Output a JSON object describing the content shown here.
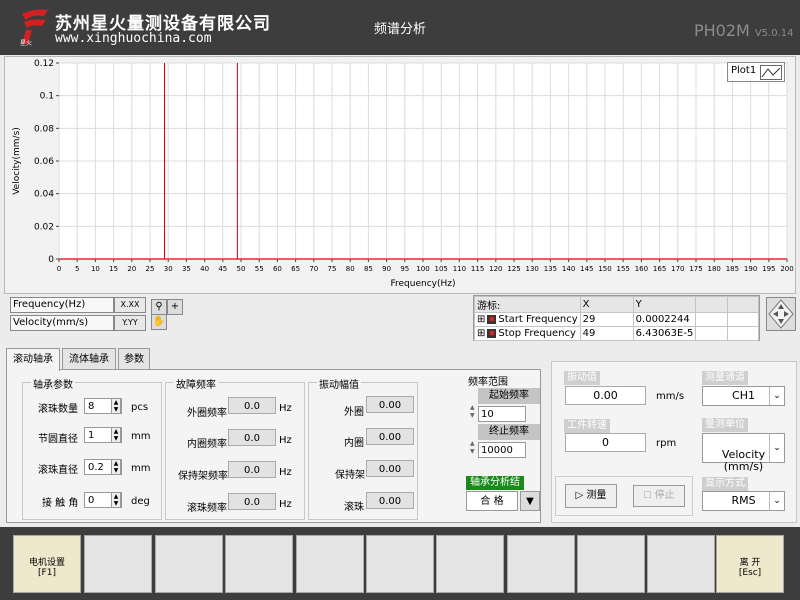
{
  "header": {
    "company_cn": "苏州星火量测设备有限公司",
    "company_url": "www.xinghuochina.com",
    "title": "频谱分析",
    "model": "PH02M",
    "version": "V5.0.14",
    "brand_color": "#d42020"
  },
  "plot": {
    "legend_label": "Plot1"
  },
  "chart_data": {
    "type": "line",
    "xlabel": "Frequency(Hz)",
    "ylabel": "Velocity(mm/s)",
    "xlim": [
      0,
      200
    ],
    "ylim": [
      0,
      0.12
    ],
    "x_ticks": [
      0,
      5,
      10,
      15,
      20,
      25,
      30,
      35,
      40,
      45,
      50,
      55,
      60,
      65,
      70,
      75,
      80,
      85,
      90,
      95,
      100,
      105,
      110,
      115,
      120,
      125,
      130,
      135,
      140,
      145,
      150,
      155,
      160,
      165,
      170,
      175,
      180,
      185,
      190,
      195,
      200
    ],
    "y_ticks": [
      0,
      0.02,
      0.04,
      0.06,
      0.08,
      0.1,
      0.12
    ],
    "y_tick_labels": [
      "0",
      "0.02",
      "0.04",
      "0.06",
      "0.08",
      "0.1",
      "0.12"
    ],
    "grid": true,
    "series": [
      {
        "name": "Plot1",
        "color": "#e03030",
        "x": [
          0,
          200
        ],
        "values": [
          0,
          0
        ]
      }
    ],
    "cursors": [
      {
        "label": "Start Frequency",
        "x": 29,
        "color": "#cc0000"
      },
      {
        "label": "Stop Frequency",
        "x": 49,
        "color": "#cc0000"
      }
    ]
  },
  "scale_legend": {
    "x_label": "Frequency(Hz)",
    "y_label": "Velocity(mm/s)",
    "x_format": "X.XX",
    "y_format": "Y.YY"
  },
  "cursor_table": {
    "header": [
      "游标:",
      "X",
      "Y"
    ],
    "rows": [
      {
        "name": "Start Frequency",
        "x": "29",
        "y": "0.0002244"
      },
      {
        "name": "Stop Frequency",
        "x": "49",
        "y": "6.43063E-5"
      }
    ]
  },
  "tabs": [
    {
      "label": "滚动轴承"
    },
    {
      "label": "流体轴承"
    },
    {
      "label": "参数"
    }
  ],
  "bearing_params": {
    "title": "轴承参数",
    "ball_count_label": "滚珠数量",
    "ball_count": "8",
    "ball_count_unit": "pcs",
    "pitch_label": "节圆直径",
    "pitch": "1",
    "pitch_unit": "mm",
    "ball_dia_label": "滚珠直径",
    "ball_dia": "0.2",
    "ball_dia_unit": "mm",
    "contact_label": "接 触 角",
    "contact": "0",
    "contact_unit": "deg"
  },
  "fault_freq": {
    "title": "故障频率",
    "outer_label": "外圈频率",
    "outer": "0.0",
    "inner_label": "内圈频率",
    "inner": "0.0",
    "cage_label": "保持架频率",
    "cage": "0.0",
    "ball_label": "滚珠频率",
    "ball": "0.0",
    "unit": "Hz"
  },
  "vib_amp": {
    "title": "振动幅值",
    "outer_label": "外圈",
    "outer": "0.00",
    "inner_label": "内圈",
    "inner": "0.00",
    "cage_label": "保持架",
    "cage": "0.00",
    "ball_label": "滚珠",
    "ball": "0.00"
  },
  "freq_range": {
    "title": "频率范围",
    "start_label": "起始频率",
    "start": "10",
    "stop_label": "终止频率",
    "stop": "10000"
  },
  "result": {
    "label": "轴承分析结论",
    "value": "合 格",
    "label_color": "#1a8a1a"
  },
  "measure": {
    "vib_label": "振动值",
    "vib_value": "0.00",
    "vib_unit": "mm/s",
    "speed_label": "工件转速",
    "speed_value": "0",
    "speed_unit": "rpm",
    "channel_label": "测量通道",
    "channel": "CH1",
    "unit_label": "量测单位",
    "unit_value": "Velocity\n(mm/s)",
    "display_label": "显示方式",
    "display": "RMS",
    "start_btn": "测量",
    "stop_btn": "停止"
  },
  "fkeys": [
    {
      "line1": "电机设置",
      "line2": "[F1]"
    },
    {
      "line1": "",
      "line2": ""
    },
    {
      "line1": "",
      "line2": ""
    },
    {
      "line1": "",
      "line2": ""
    },
    {
      "line1": "",
      "line2": ""
    },
    {
      "line1": "",
      "line2": ""
    },
    {
      "line1": "",
      "line2": ""
    },
    {
      "line1": "",
      "line2": ""
    },
    {
      "line1": "",
      "line2": ""
    },
    {
      "line1": "",
      "line2": ""
    },
    {
      "line1": "离 开",
      "line2": "[Esc]"
    }
  ]
}
